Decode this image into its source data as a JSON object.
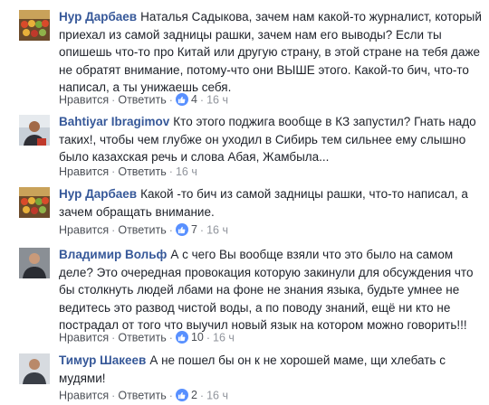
{
  "comments": [
    {
      "author": "Нур Дарбаев",
      "text": "Наталья Садыкова, зачем нам какой-то журналист, который приехал из самой задницы рашки, зачем нам его выводы? Если ты опишешь что-то про Китай или другую страну, в этой стране на тебя даже не обратят внимание, потому-что они ВЫШЕ этого. Какой-то бич, что-то написал, а ты унижаешь себя.",
      "like_label": "Нравится",
      "reply_label": "Ответить",
      "likes": "4",
      "time": "16 ч",
      "avatar_icon": "avatar-fruit-market-icon"
    },
    {
      "author": "Bahtiyar Ibragimov",
      "text": "Кто этого поджига вообще в КЗ запустил? Гнать надо таких!, чтобы чем глубже он уходил в Сибирь тем сильнее ему слышно было казахская речь и слова Абая, Жамбыла...",
      "like_label": "Нравится",
      "reply_label": "Ответить",
      "likes": "",
      "time": "16 ч",
      "avatar_icon": "avatar-person-icon"
    },
    {
      "author": "Нур Дарбаев",
      "text": "Какой -то бич из самой задницы рашки, что-то написал, а зачем обращать внимание.",
      "like_label": "Нравится",
      "reply_label": "Ответить",
      "likes": "7",
      "time": "16 ч",
      "avatar_icon": "avatar-fruit-market-icon"
    },
    {
      "author": "Владимир Вольф",
      "text": "А с чего Вы вообще взяли что это было на самом деле? Это очередная провокация которую закинули для обсуждения что бы столкнуть людей лбами на фоне не знания языка, будьте умнее не ведитесь это развод чистой воды, а по поводу знаний, ещё ни кто не пострадал от того что выучил новый язык на котором можно говорить!!!",
      "like_label": "Нравится",
      "reply_label": "Ответить",
      "likes": "10",
      "time": "16 ч",
      "avatar_icon": "avatar-person-icon"
    },
    {
      "author": "Тимур Шакеев",
      "text": "А не пошел бы он к не хорошей маме, щи хлебать с мудями!",
      "like_label": "Нравится",
      "reply_label": "Ответить",
      "likes": "2",
      "time": "16 ч",
      "avatar_icon": "avatar-person-icon"
    }
  ],
  "colors": {
    "author": "#365899",
    "like_badge": "#5890ff",
    "meta": "#90949c"
  }
}
